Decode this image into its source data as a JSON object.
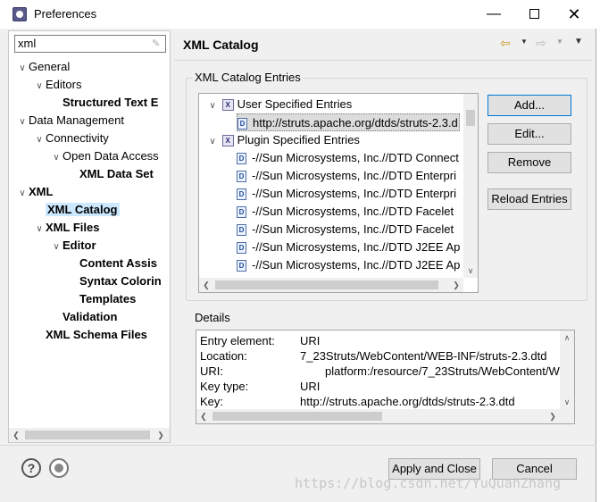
{
  "window": {
    "title": "Preferences"
  },
  "filter": {
    "value": "xml"
  },
  "tree": [
    {
      "label": "General",
      "twisty": "expanded",
      "bold": false,
      "depth": 0
    },
    {
      "label": "Editors",
      "twisty": "expanded",
      "bold": false,
      "depth": 1
    },
    {
      "label": "Structured Text E",
      "twisty": "none",
      "bold": true,
      "depth": 2
    },
    {
      "label": "Data Management",
      "twisty": "expanded",
      "bold": false,
      "depth": 0
    },
    {
      "label": "Connectivity",
      "twisty": "expanded",
      "bold": false,
      "depth": 1
    },
    {
      "label": "Open Data Access",
      "twisty": "expanded",
      "bold": false,
      "depth": 2
    },
    {
      "label": "XML Data Set",
      "twisty": "none",
      "bold": true,
      "depth": 3
    },
    {
      "label": "XML",
      "twisty": "expanded",
      "bold": true,
      "depth": 0
    },
    {
      "label": "XML Catalog",
      "twisty": "none",
      "bold": true,
      "depth": 1,
      "selected": true
    },
    {
      "label": "XML Files",
      "twisty": "expanded",
      "bold": true,
      "depth": 1
    },
    {
      "label": "Editor",
      "twisty": "expanded",
      "bold": true,
      "depth": 2
    },
    {
      "label": "Content Assis",
      "twisty": "none",
      "bold": true,
      "depth": 3
    },
    {
      "label": "Syntax Colorin",
      "twisty": "none",
      "bold": true,
      "depth": 3
    },
    {
      "label": "Templates",
      "twisty": "none",
      "bold": true,
      "depth": 3
    },
    {
      "label": "Validation",
      "twisty": "none",
      "bold": true,
      "depth": 2
    },
    {
      "label": "XML Schema Files",
      "twisty": "none",
      "bold": true,
      "depth": 1
    }
  ],
  "page": {
    "title": "XML Catalog",
    "entries_group_label": "XML Catalog Entries",
    "details_group_label": "Details"
  },
  "entries": {
    "user_group": "User Specified Entries",
    "user_items": [
      "http://struts.apache.org/dtds/struts-2.3.d"
    ],
    "plugin_group": "Plugin Specified Entries",
    "plugin_items": [
      "-//Sun Microsystems, Inc.//DTD Connect",
      "-//Sun Microsystems, Inc.//DTD Enterpri",
      "-//Sun Microsystems, Inc.//DTD Enterpri",
      "-//Sun Microsystems, Inc.//DTD Facelet",
      "-//Sun Microsystems, Inc.//DTD Facelet",
      "-//Sun Microsystems, Inc.//DTD J2EE Ap",
      "-//Sun Microsystems, Inc.//DTD J2EE Ap"
    ]
  },
  "buttons": {
    "add": "Add...",
    "edit": "Edit...",
    "remove": "Remove",
    "reload": "Reload Entries",
    "apply_close": "Apply and Close",
    "cancel": "Cancel"
  },
  "details": [
    {
      "key": "Entry element:",
      "value": "URI"
    },
    {
      "key": "Location:",
      "value": "7_23Struts/WebContent/WEB-INF/struts-2.3.dtd"
    },
    {
      "key": "URI:",
      "value": "platform:/resource/7_23Struts/WebContent/W"
    },
    {
      "key": "Key type:",
      "value": "URI"
    },
    {
      "key": "Key:",
      "value": "http://struts.apache.org/dtds/struts-2.3.dtd"
    }
  ],
  "icons": {
    "help": "?",
    "dtd": "D",
    "catalog": "X"
  },
  "watermark": "https://blog.csdn.net/YuQuanZhang"
}
